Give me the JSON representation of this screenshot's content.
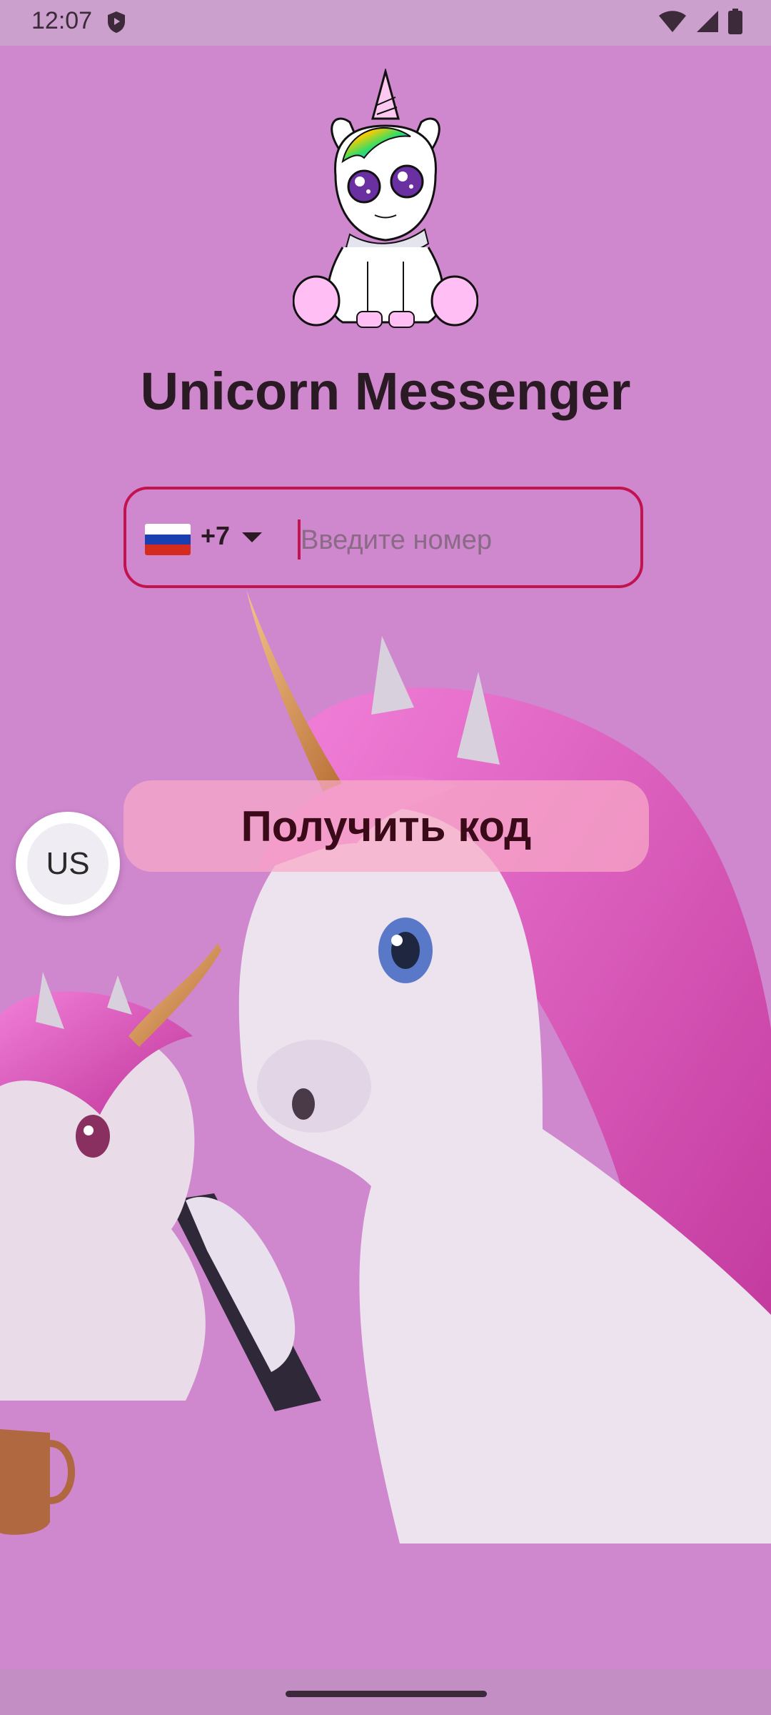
{
  "status_bar": {
    "time": "12:07",
    "icons": [
      "shield-icon",
      "wifi-icon",
      "cell-signal-icon",
      "battery-icon"
    ]
  },
  "app": {
    "title": "Unicorn Messenger",
    "logo": "unicorn-cartoon-logo"
  },
  "phone_field": {
    "country_flag": "russia-flag",
    "country_code": "+7",
    "value": "",
    "placeholder": "Введите номер"
  },
  "get_code_button": {
    "label": "Получить код"
  },
  "language_fab": {
    "label": "US"
  },
  "illustration": "two-unicorns-with-phone",
  "colors": {
    "background": "#CF87CE",
    "accent": "#C2134F",
    "button": "#F8AAC8"
  }
}
